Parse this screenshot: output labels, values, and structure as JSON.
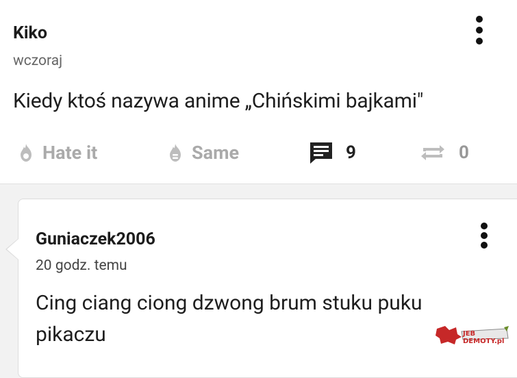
{
  "post": {
    "author": "Kiko",
    "time": "wczoraj",
    "text": "Kiedy ktoś nazywa anime „Chińskimi bajkami\"",
    "actions": {
      "hate_label": "Hate it",
      "same_label": "Same",
      "comments_count": "9",
      "reposts_count": "0"
    }
  },
  "comment": {
    "author": "Guniaczek2006",
    "time": "20 godz. temu",
    "text": "Cing ciang ciong dzwong brum stuku puku pikaczu"
  },
  "watermark": {
    "text": "JEB DEMOTY.pl"
  },
  "icons": {
    "menu": "more-vert-icon",
    "hate": "flame-icon",
    "same": "flame-outline-icon",
    "comments": "comment-icon",
    "repost": "repost-icon"
  },
  "colors": {
    "background": "#f2f2f2",
    "card": "#ffffff",
    "text": "#1e1e1e",
    "muted": "#aaaaaa",
    "watermark": "#c62828"
  }
}
